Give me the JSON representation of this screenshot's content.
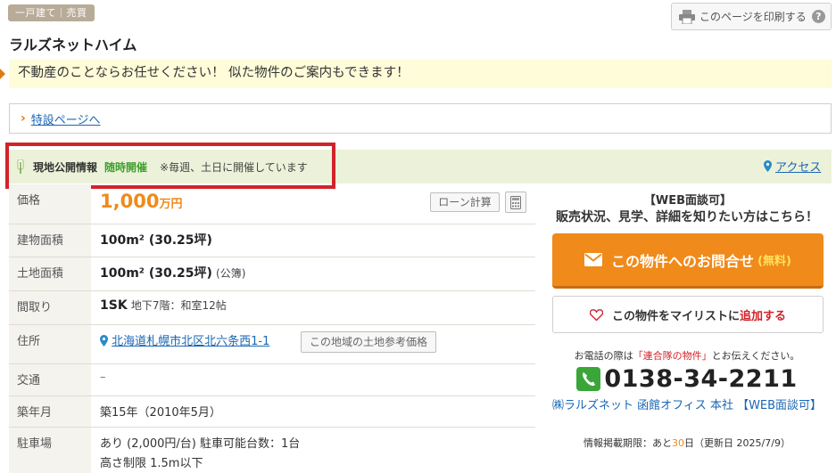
{
  "badge": "一戸建て｜売買",
  "print": {
    "label": "このページを印刷する",
    "help": "?"
  },
  "title": "ラルズネットハイム",
  "catch": "不動産のことならお任せください！ 似た物件のご案内もできます！",
  "special_link": "特設ページへ",
  "open_house": {
    "label": "現地公開情報",
    "status": "随時開催",
    "note": "※毎週、土日に開催しています"
  },
  "access_link": "アクセス",
  "spec": {
    "price_label": "価格",
    "price_value": "1,000",
    "price_unit": "万円",
    "loan_button": "ローン計算",
    "building_label": "建物面積",
    "building_value": "100m² (30.25坪)",
    "land_label": "土地面積",
    "land_value": "100m² (30.25坪)",
    "land_note": "(公簿)",
    "layout_label": "間取り",
    "layout_value": "1SK",
    "layout_note": "地下7階：和室12帖",
    "address_label": "住所",
    "address_value": "北海道札幌市北区北六条西1-1",
    "area_button": "この地域の土地参考価格",
    "transport_label": "交通",
    "transport_value": "–",
    "age_label": "築年月",
    "age_value": "築15年（2010年5月）",
    "parking_label": "駐車場",
    "parking_line1": "あり (2,000円/台) 駐車可能台数：1台",
    "parking_line2": "高さ制限 1.5m以下"
  },
  "side": {
    "heading1": "【WEB面談可】",
    "heading2": "販売状況、見学、詳細を知りたい方はこちら！",
    "inquiry_label": "この物件へのお問合せ",
    "inquiry_free": "(無料)",
    "fav_pre": "この物件をマイリストに",
    "fav_action": "追加する",
    "tel_note_pre": "お電話の際は",
    "tel_note_highlight": "「連合隊の物件」",
    "tel_note_post": "とお伝えください。",
    "tel": "0138-34-2211",
    "company": "㈱ラルズネット 函館オフィス 本社 【WEB面談可】",
    "expiry_pre": "情報掲載期限：あと",
    "expiry_days": "30",
    "expiry_post": "日（更新日 2025/7/9）"
  },
  "colors": {
    "accent": "#f08a1a",
    "link": "#1a66b3",
    "highlight_red": "#d2232a",
    "open_green": "#3f9f2e"
  }
}
